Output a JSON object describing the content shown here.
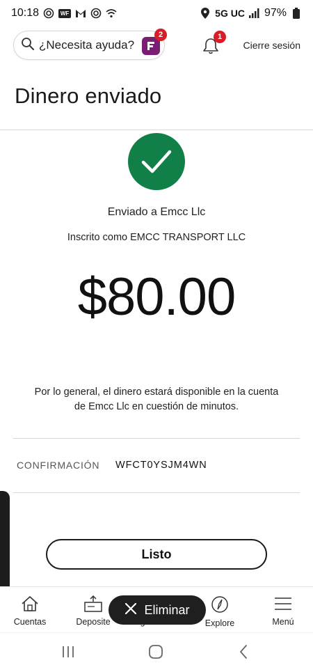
{
  "status_bar": {
    "time": "10:18",
    "network": "5G UC",
    "battery": "97%",
    "wf_icon_text": "WF",
    "icons_left": [
      "wireless-icon",
      "wf-app-icon",
      "gmail-icon",
      "wireless-icon",
      "wifi-icon"
    ],
    "icons_right": [
      "location-icon",
      "signal-icon",
      "battery-icon"
    ]
  },
  "header": {
    "search_label": "¿Necesita ayuda?",
    "fargo_badge_count": "2",
    "bell_badge_count": "1",
    "logout_label": "Cierre sesión"
  },
  "page": {
    "title": "Dinero enviado",
    "sent_to": "Enviado a Emcc Llc",
    "enrolled_as": "Inscrito como EMCC TRANSPORT LLC",
    "amount": "$80.00",
    "availability_line1": "Por lo general, el dinero estará disponible en la cuenta",
    "availability_line2": "de Emcc Llc en cuestión de minutos.",
    "confirmation_label": "CONFIRMACIÓN",
    "confirmation_value": "WFCT0YSJM4WN",
    "done_label": "Listo"
  },
  "bottom_nav": {
    "items": [
      {
        "label": "Cuentas",
        "icon": "home-icon"
      },
      {
        "label": "Deposite",
        "icon": "deposit-icon"
      },
      {
        "label": "Pagar/Transf.",
        "icon": "transfer-icon"
      },
      {
        "label": "Explore",
        "icon": "compass-icon"
      },
      {
        "label": "Menú",
        "icon": "menu-icon"
      }
    ]
  },
  "delete_label": "Eliminar",
  "colors": {
    "success_green": "#118048",
    "badge_red": "#d71e28",
    "fargo_purple": "#7a1e74"
  }
}
